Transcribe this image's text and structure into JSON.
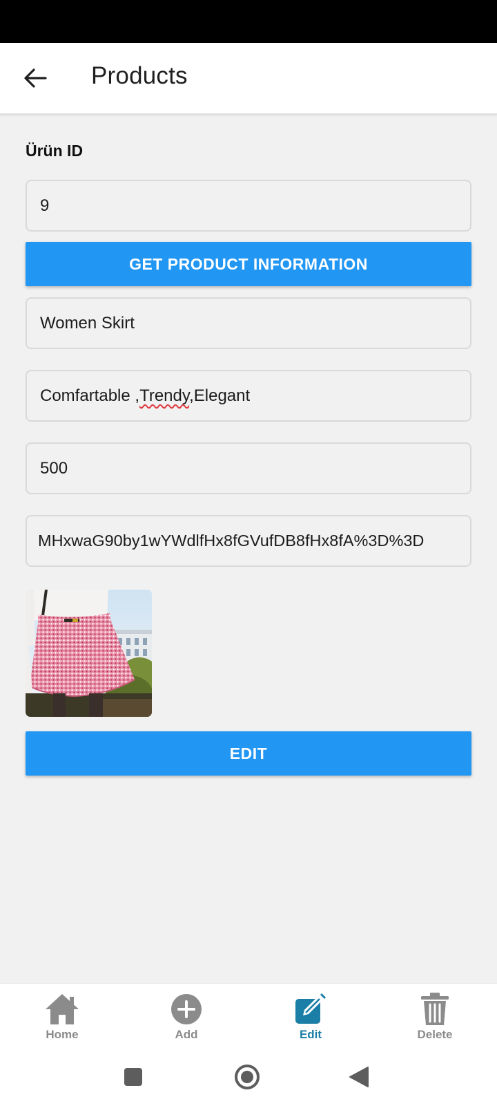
{
  "header": {
    "title": "Products",
    "back_icon": "arrow-left-icon"
  },
  "form": {
    "id_label": "Ürün ID",
    "id_value": "9",
    "get_button_label": "GET PRODUCT INFORMATION",
    "name_value": "Women Skirt",
    "description_prefix": "Comfartable ,",
    "description_misspelled": "Trendy",
    "description_suffix": ",Elegant",
    "price_value": "500",
    "image_url_value": "MHxwaG90by1wYWdlfHx8fGVufDB8fHx8fA%3D%3D",
    "edit_button_label": "EDIT"
  },
  "image": {
    "subject": "photo of a pink patterned women skirt"
  },
  "bottom_nav": {
    "items": [
      {
        "label": "Home",
        "icon": "home-icon",
        "active": false
      },
      {
        "label": "Add",
        "icon": "add-circle-icon",
        "active": false
      },
      {
        "label": "Edit",
        "icon": "edit-icon",
        "active": true
      },
      {
        "label": "Delete",
        "icon": "trash-icon",
        "active": false
      }
    ]
  },
  "colors": {
    "primary": "#2196f3",
    "active_nav": "#1a7ea6",
    "inactive_nav": "#8b8b8b",
    "background": "#f1f1f1"
  }
}
